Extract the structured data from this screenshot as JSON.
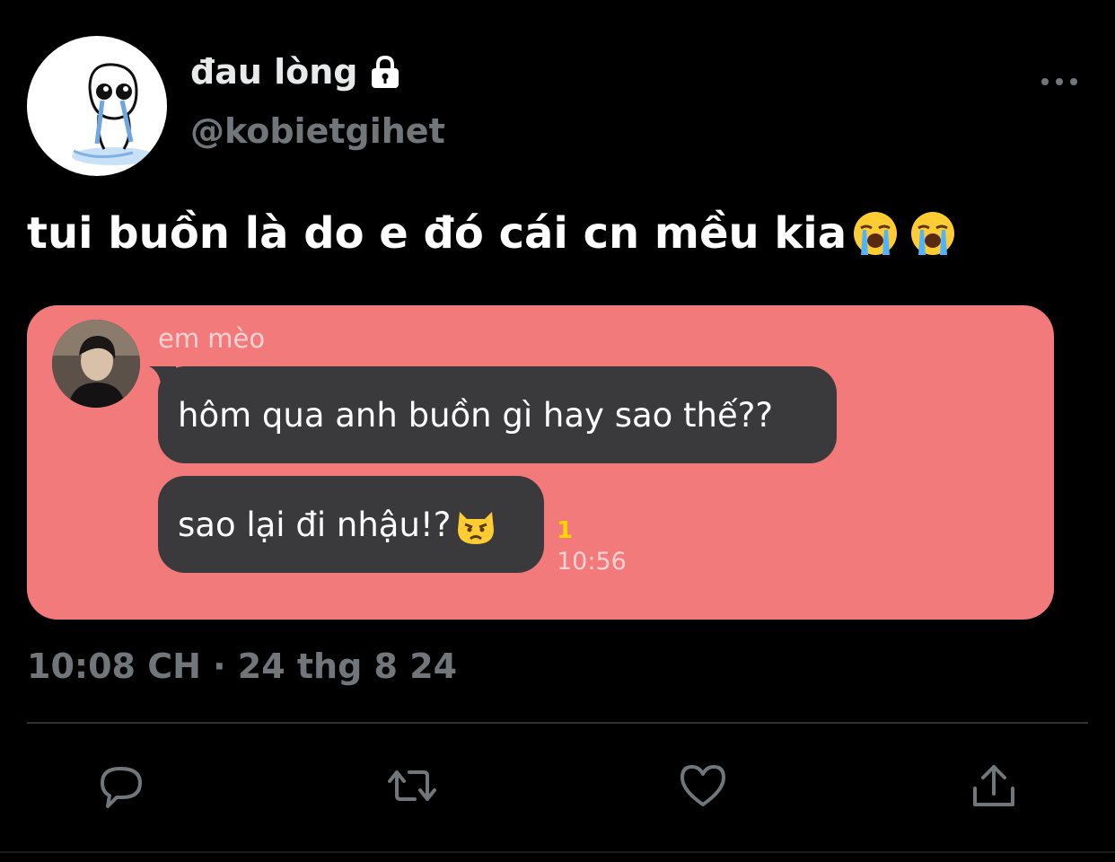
{
  "tweet": {
    "display_name": "đau lòng",
    "handle": "@kobietgihet",
    "text": "tui buồn là do e đó cái cn mều kia",
    "emojis": [
      "loudly-crying-face",
      "loudly-crying-face"
    ],
    "timestamp": "10:08 CH · 24 thg 8 24"
  },
  "chat": {
    "sender": "em mèo",
    "messages": [
      {
        "text": "hôm qua anh buồn gì hay sao thế??"
      },
      {
        "text": "sao lại đi nhậu!?",
        "emoji": "pouting-cat-face"
      }
    ],
    "unread_count": "1",
    "time": "10:56"
  },
  "colors": {
    "background": "#000000",
    "secondary_text": "#71767b",
    "media_background": "#f27a7b",
    "bubble": "#3a3a3c",
    "unread": "#ffd400"
  },
  "icons": [
    "lock-icon",
    "more-icon",
    "reply-icon",
    "retweet-icon",
    "like-icon",
    "share-icon"
  ]
}
